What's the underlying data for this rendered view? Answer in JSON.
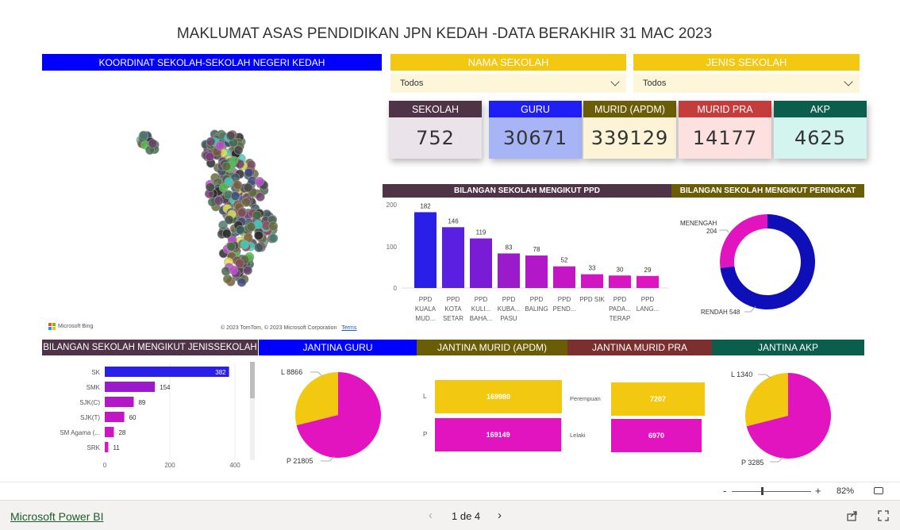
{
  "report_title": "MAKLUMAT ASAS PENDIDIKAN JPN KEDAH -DATA BERAKHIR 31 MAC 2023",
  "map": {
    "header": "KOORDINAT SEKOLAH-SEKOLAH NEGERI KEDAH",
    "bing_label": "Microsoft Bing",
    "copyright": "© 2023 TomTom, © 2023 Microsoft Corporation",
    "terms": "Terms"
  },
  "slicers": [
    {
      "header": "NAMA SEKOLAH",
      "value": "Todos"
    },
    {
      "header": "JENIS SEKOLAH",
      "value": "Todos"
    }
  ],
  "cards": [
    {
      "label": "SEKOLAH",
      "value": "752",
      "header_color": "#4f3447",
      "body_color": "#ebe3ea"
    },
    {
      "label": "GURU",
      "value": "30671",
      "header_color": "#1f1ff5",
      "body_color": "#a7b5f7"
    },
    {
      "label": "MURID (APDM)",
      "value": "339129",
      "header_color": "#6a5d06",
      "body_color": "#fdf4d8"
    },
    {
      "label": "MURID PRA",
      "value": "14177",
      "header_color": "#c43c3c",
      "body_color": "#fde1e1"
    },
    {
      "label": "AKP",
      "value": "4625",
      "header_color": "#0c5e4c",
      "body_color": "#d4f4ef"
    }
  ],
  "colors": {
    "blue": "#1f1ff5",
    "yellow": "#f2c811",
    "magenta": "#e214bf",
    "navy": "#0e0fb8",
    "purple": "#a21cd0",
    "olive": "#6a5d06",
    "maroon": "#4f3447",
    "darkred": "#7b2f2f",
    "teal": "#0c5e4c"
  },
  "ppd_chart": {
    "header": "BILANGAN SEKOLAH MENGIKUT PPD",
    "y_ticks": [
      "200",
      "100",
      "0"
    ]
  },
  "peringkat_chart": {
    "header": "BILANGAN SEKOLAH MENGIKUT PERINGKAT",
    "label_menengah": "MENENGAH",
    "value_menengah": "204",
    "label_rendah": "RENDAH 548"
  },
  "jenis_chart": {
    "header": "BILANGAN SEKOLAH MENGIKUT JENISSEKOLAH",
    "x_ticks": [
      "0",
      "200",
      "400"
    ]
  },
  "jantina_guru": {
    "header": "JANTINA GURU",
    "label_l": "L 8866",
    "label_p": "P 21805"
  },
  "jantina_murid": {
    "header": "JANTINA MURID (APDM)",
    "cat_l": "L",
    "cat_p": "P",
    "val_l": "169980",
    "val_p": "169149"
  },
  "jantina_pra": {
    "header": "JANTINA MURID PRA",
    "cat_f": "Perempuan",
    "cat_m": "Lelaki",
    "val_f": "7207",
    "val_m": "6970"
  },
  "jantina_akp": {
    "header": "JANTINA AKP",
    "label_l": "L 1340",
    "label_p": "P 3285"
  },
  "zoom": {
    "minus": "-",
    "plus": "+",
    "value": "82%"
  },
  "footer": {
    "brand": "Microsoft Power BI",
    "pages": "1 de 4"
  },
  "chart_data": [
    {
      "type": "bar",
      "title": "BILANGAN SEKOLAH MENGIKUT PPD",
      "categories": [
        "PPD KUALA MUD...",
        "PPD KOTA SETAR",
        "PPD KULI... BAHA...",
        "PPD KUBA... PASU",
        "PPD BALING",
        "PPD PEND...",
        "PPD SIK",
        "PPD PADA... TERAP",
        "PPD LANG..."
      ],
      "values": [
        182,
        146,
        119,
        83,
        78,
        52,
        33,
        30,
        29
      ],
      "ylim": [
        0,
        200
      ],
      "colors": [
        "#2a1fe8",
        "#5a1fe0",
        "#7a1cd6",
        "#9a1acc",
        "#b218c8",
        "#c416c5",
        "#d015c2",
        "#d815c0",
        "#dc15bf"
      ]
    },
    {
      "type": "pie",
      "title": "BILANGAN SEKOLAH MENGIKUT PERINGKAT",
      "categories": [
        "MENENGAH",
        "RENDAH"
      ],
      "values": [
        204,
        548
      ],
      "colors": [
        "#e214bf",
        "#0e0fb8"
      ]
    },
    {
      "type": "bar",
      "title": "BILANGAN SEKOLAH MENGIKUT JENISSEKOLAH",
      "orientation": "horizontal",
      "categories": [
        "SK",
        "SMK",
        "SJK(C)",
        "SJK(T)",
        "SM Agama (...",
        "SRK"
      ],
      "values": [
        382,
        154,
        89,
        60,
        28,
        11
      ],
      "xlim": [
        0,
        400
      ],
      "colors": [
        "#2a1fe8",
        "#9a1acc",
        "#b218c8",
        "#c416c5",
        "#d015c2",
        "#dc15bf"
      ]
    },
    {
      "type": "pie",
      "title": "JANTINA GURU",
      "categories": [
        "L",
        "P"
      ],
      "values": [
        8866,
        21805
      ],
      "colors": [
        "#f2c811",
        "#e214bf"
      ]
    },
    {
      "type": "bar",
      "title": "JANTINA MURID (APDM)",
      "categories": [
        "L",
        "P"
      ],
      "values": [
        169980,
        169149
      ],
      "colors": [
        "#f2c811",
        "#e214bf"
      ]
    },
    {
      "type": "bar",
      "title": "JANTINA MURID PRA",
      "categories": [
        "Perempuan",
        "Lelaki"
      ],
      "values": [
        7207,
        6970
      ],
      "colors": [
        "#f2c811",
        "#e214bf"
      ]
    },
    {
      "type": "pie",
      "title": "JANTINA AKP",
      "categories": [
        "L",
        "P"
      ],
      "values": [
        1340,
        3285
      ],
      "colors": [
        "#f2c811",
        "#e214bf"
      ]
    }
  ]
}
